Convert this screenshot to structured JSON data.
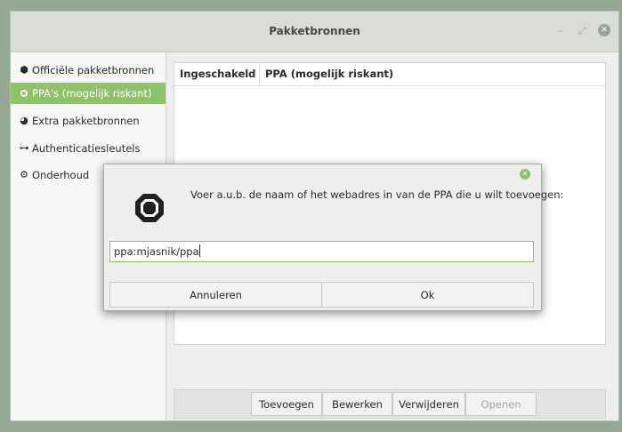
{
  "window": {
    "title": "Pakketbronnen",
    "controls": {
      "minimize": "–",
      "maximize": "⤢",
      "close": "✕"
    }
  },
  "sidebar": {
    "items": [
      {
        "label": "Officiële pakketbronnen",
        "icon": "package-icon",
        "glyph": "⬢",
        "active": false
      },
      {
        "label": "PPA's (mogelijk riskant)",
        "icon": "radio-icon",
        "glyph": "",
        "active": true
      },
      {
        "label": "Extra pakketbronnen",
        "icon": "globe-icon",
        "glyph": "◕",
        "active": false
      },
      {
        "label": "Authenticatiesleutels",
        "icon": "key-icon",
        "glyph": "⊶",
        "active": false
      },
      {
        "label": "Onderhoud",
        "icon": "maintenance-icon",
        "glyph": "⚙",
        "active": false
      }
    ]
  },
  "table": {
    "columns": [
      "Ingeschakeld",
      "PPA (mogelijk riskant)"
    ]
  },
  "buttons": {
    "add": "Toevoegen",
    "edit": "Bewerken",
    "remove": "Verwijderen",
    "open": "Openen"
  },
  "dialog": {
    "message": "Voer a.u.b. de naam of het webadres in van de PPA die u wilt toevoegen:",
    "input_value": "ppa:mjasnik/ppa",
    "cancel": "Annuleren",
    "ok": "Ok",
    "close_glyph": "✕"
  },
  "colors": {
    "accent": "#8fc06a",
    "desktop": "#94a893",
    "titlebar": "#d9dcd7"
  }
}
